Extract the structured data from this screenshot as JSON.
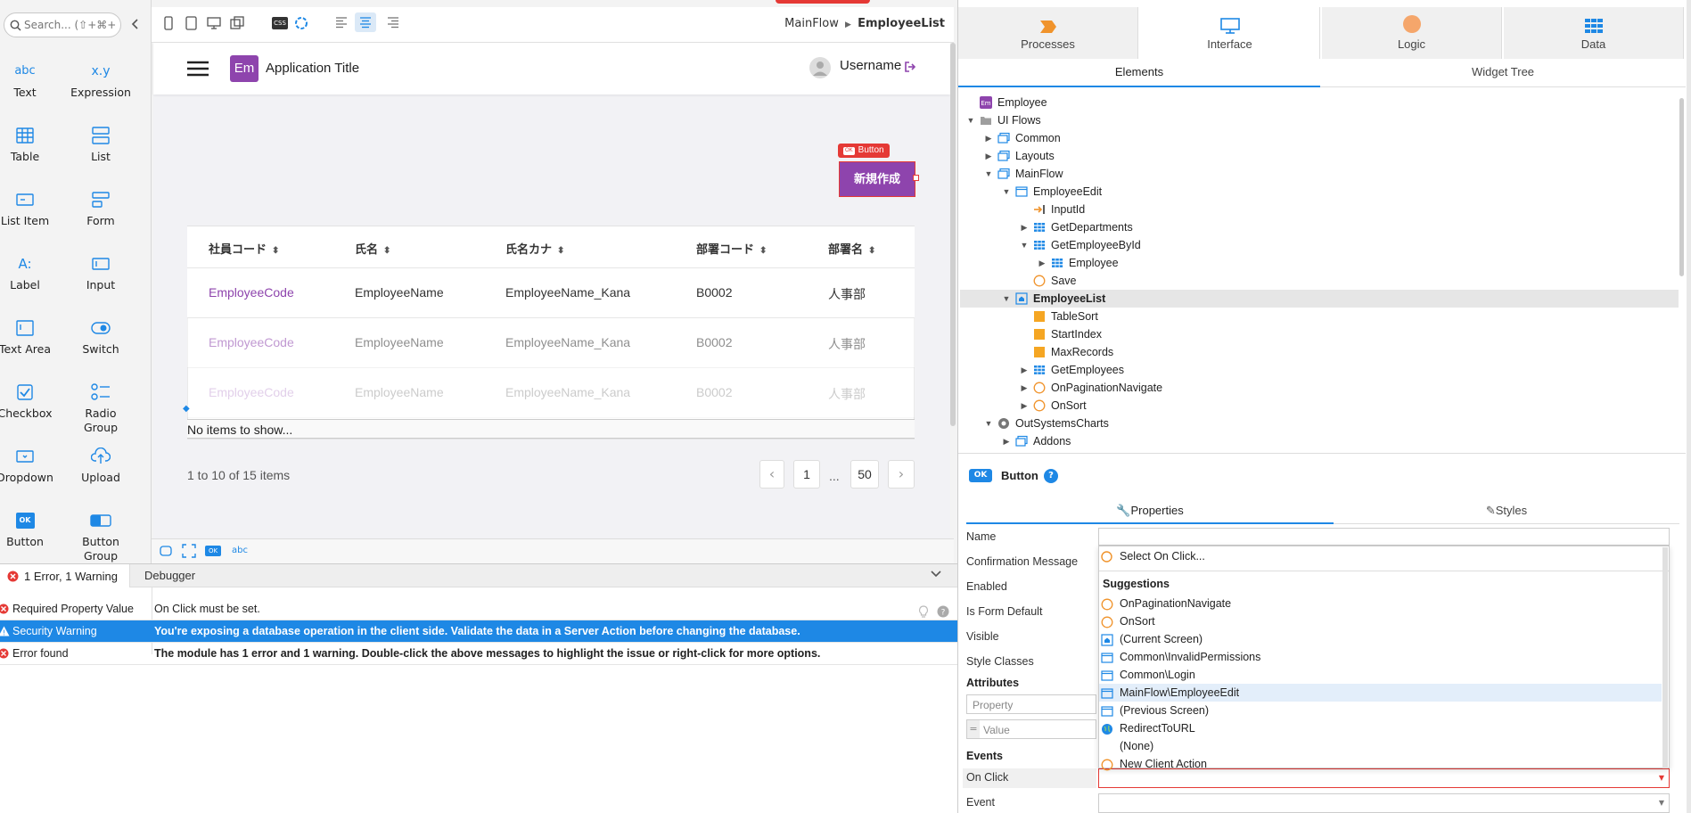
{
  "toolbox": {
    "search_placeholder": "Search... (⇧+⌘+E",
    "tools": [
      {
        "label": "Text",
        "icon": "text-widget-icon",
        "glyph": "abc"
      },
      {
        "label": "Expression",
        "icon": "expression-widget-icon",
        "glyph": "x.y"
      },
      {
        "label": "Table",
        "icon": "table-widget-icon"
      },
      {
        "label": "List",
        "icon": "list-widget-icon"
      },
      {
        "label": "List Item",
        "icon": "list-item-widget-icon"
      },
      {
        "label": "Form",
        "icon": "form-widget-icon"
      },
      {
        "label": "Label",
        "icon": "label-widget-icon",
        "glyph": "A:"
      },
      {
        "label": "Input",
        "icon": "input-widget-icon"
      },
      {
        "label": "Text Area",
        "icon": "text-area-widget-icon"
      },
      {
        "label": "Switch",
        "icon": "switch-widget-icon"
      },
      {
        "label": "Checkbox",
        "icon": "checkbox-widget-icon"
      },
      {
        "label": "Radio\nGroup",
        "icon": "radio-group-widget-icon"
      },
      {
        "label": "Dropdown",
        "icon": "dropdown-widget-icon"
      },
      {
        "label": "Upload",
        "icon": "upload-widget-icon"
      },
      {
        "label": "Button",
        "icon": "button-widget-icon",
        "glyph": "OK"
      },
      {
        "label": "Button\nGroup",
        "icon": "button-group-widget-icon"
      }
    ]
  },
  "canvas": {
    "breadcrumb_parent": "MainFlow",
    "breadcrumb_current": "EmployeeList",
    "toolbar_css": "CSS",
    "app": {
      "logo_text": "Em",
      "title": "Application Title",
      "username": "Username"
    },
    "button_badge": "Button",
    "button_badge_icon": "OK",
    "new_button_label": "新規作成",
    "table": {
      "headers": [
        "社員コード",
        "氏名",
        "氏名カナ",
        "部署コード",
        "部署名"
      ],
      "rows": [
        [
          "EmployeeCode",
          "EmployeeName",
          "EmployeeName_Kana",
          "B0002",
          "人事部"
        ],
        [
          "EmployeeCode",
          "EmployeeName",
          "EmployeeName_Kana",
          "B0002",
          "人事部"
        ],
        [
          "EmployeeCode",
          "EmployeeName",
          "EmployeeName_Kana",
          "B0002",
          "人事部"
        ]
      ],
      "empty_message": "No items to show..."
    },
    "pagination": {
      "summary": "1 to 10 of 15 items",
      "prev": "‹",
      "page_first": "1",
      "ellipsis": "...",
      "page_last": "50",
      "next": "›"
    },
    "bottom_badge_ok": "OK",
    "bottom_abc": "abc"
  },
  "errors": {
    "tab_label": "1 Error, 1 Warning",
    "debugger_label": "Debugger",
    "rows": [
      {
        "type": "Required Property Value",
        "message": "On Click must be set.",
        "severity": "error"
      },
      {
        "type": "Security Warning",
        "message": "You're exposing a database operation in the client side. Validate the data in a Server Action before changing the database.",
        "severity": "warning"
      },
      {
        "type": "Error found",
        "message": "The module has 1 error and 1 warning. Double-click the above messages to highlight the issue or right-click for more options.",
        "severity": "error"
      }
    ]
  },
  "right_panel": {
    "tabs": [
      {
        "label": "Processes",
        "icon": "processes-icon"
      },
      {
        "label": "Interface",
        "icon": "interface-icon"
      },
      {
        "label": "Logic",
        "icon": "logic-icon"
      },
      {
        "label": "Data",
        "icon": "data-icon"
      }
    ],
    "subtabs": [
      "Elements",
      "Widget Tree"
    ],
    "tree": [
      {
        "label": "Employee",
        "depth": 0,
        "icon": "module-icon",
        "arrow": ""
      },
      {
        "label": "UI Flows",
        "depth": 0,
        "icon": "folder-icon",
        "arrow": "▼"
      },
      {
        "label": "Common",
        "depth": 1,
        "icon": "flow-icon",
        "arrow": "▶"
      },
      {
        "label": "Layouts",
        "depth": 1,
        "icon": "flow-icon",
        "arrow": "▶"
      },
      {
        "label": "MainFlow",
        "depth": 1,
        "icon": "flow-icon",
        "arrow": "▼"
      },
      {
        "label": "EmployeeEdit",
        "depth": 2,
        "icon": "screen-icon",
        "arrow": "▼"
      },
      {
        "label": "InputId",
        "depth": 3,
        "icon": "input-param-icon",
        "arrow": ""
      },
      {
        "label": "GetDepartments",
        "depth": 3,
        "icon": "aggregate-icon",
        "arrow": "▶"
      },
      {
        "label": "GetEmployeeById",
        "depth": 3,
        "icon": "aggregate-icon",
        "arrow": "▼"
      },
      {
        "label": "Employee",
        "depth": 4,
        "icon": "aggregate-icon",
        "arrow": "▶"
      },
      {
        "label": "Save",
        "depth": 3,
        "icon": "action-icon",
        "arrow": ""
      },
      {
        "label": "EmployeeList",
        "depth": 2,
        "icon": "home-screen-icon",
        "arrow": "▼",
        "selected": true
      },
      {
        "label": "TableSort",
        "depth": 3,
        "icon": "local-var-icon",
        "arrow": ""
      },
      {
        "label": "StartIndex",
        "depth": 3,
        "icon": "local-var-icon",
        "arrow": ""
      },
      {
        "label": "MaxRecords",
        "depth": 3,
        "icon": "local-var-icon",
        "arrow": ""
      },
      {
        "label": "GetEmployees",
        "depth": 3,
        "icon": "aggregate-icon",
        "arrow": "▶"
      },
      {
        "label": "OnPaginationNavigate",
        "depth": 3,
        "icon": "action-icon",
        "arrow": "▶"
      },
      {
        "label": "OnSort",
        "depth": 3,
        "icon": "action-icon",
        "arrow": "▶"
      },
      {
        "label": "OutSystemsCharts",
        "depth": 1,
        "icon": "charts-icon",
        "arrow": "▼"
      },
      {
        "label": "Addons",
        "depth": 2,
        "icon": "flow-icon",
        "arrow": "▶"
      }
    ],
    "selected_widget": {
      "badge": "OK",
      "name": "Button",
      "help": "?"
    },
    "prop_tabs": [
      "Properties",
      "Styles"
    ],
    "properties": [
      "Name",
      "Confirmation Message",
      "Enabled",
      "Is Form Default",
      "Visible",
      "Style Classes"
    ],
    "attributes_header": "Attributes",
    "attr_property_placeholder": "Property",
    "attr_equals": "=",
    "attr_value_placeholder": "Value",
    "events_header": "Events",
    "on_click_label": "On Click",
    "event_label": "Event",
    "dropdown": {
      "select_label": "Select On Click...",
      "suggestions_header": "Suggestions",
      "items": [
        {
          "label": "OnPaginationNavigate",
          "icon": "action-icon"
        },
        {
          "label": "OnSort",
          "icon": "action-icon"
        },
        {
          "label": "(Current Screen)",
          "icon": "home-screen-icon"
        },
        {
          "label": "Common\\InvalidPermissions",
          "icon": "screen-icon"
        },
        {
          "label": "Common\\Login",
          "icon": "screen-icon"
        },
        {
          "label": "MainFlow\\EmployeeEdit",
          "icon": "screen-icon",
          "highlighted": true
        },
        {
          "label": "(Previous Screen)",
          "icon": "screen-icon"
        },
        {
          "label": "RedirectToURL",
          "icon": "globe-icon"
        },
        {
          "label": "(None)",
          "icon": ""
        },
        {
          "label": "New Client Action",
          "icon": "action-icon"
        }
      ]
    }
  },
  "colors": {
    "accent_blue": "#1e88e5",
    "app_purple": "#8e44ad",
    "error_red": "#e53935",
    "warning_row": "#1e88e5",
    "selected_tree": "#e6e6e6"
  }
}
